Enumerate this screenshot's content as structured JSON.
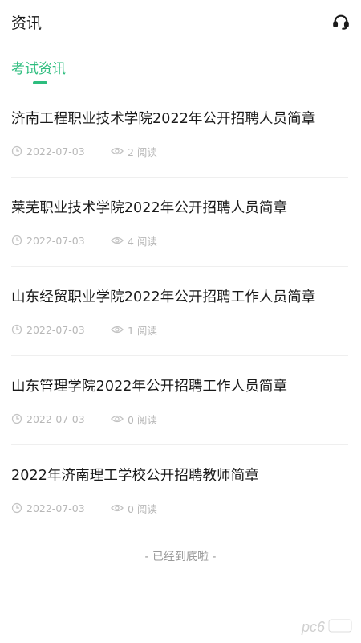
{
  "header": {
    "title": "资讯",
    "service_icon": "headset-icon"
  },
  "tabs": [
    {
      "label": "考试资讯",
      "active": true
    }
  ],
  "articles": [
    {
      "title": "济南工程职业技术学院2022年公开招聘人员简章",
      "date": "2022-07-03",
      "reads": "2 阅读"
    },
    {
      "title": "莱芜职业技术学院2022年公开招聘人员简章",
      "date": "2022-07-03",
      "reads": "4 阅读"
    },
    {
      "title": "山东经贸职业学院2022年公开招聘工作人员简章",
      "date": "2022-07-03",
      "reads": "1 阅读"
    },
    {
      "title": "山东管理学院2022年公开招聘工作人员简章",
      "date": "2022-07-03",
      "reads": "0 阅读"
    },
    {
      "title": "2022年济南理工学校公开招聘教师简章",
      "date": "2022-07-03",
      "reads": "0 阅读"
    }
  ],
  "footer": {
    "end_text": "- 已经到底啦 -"
  },
  "colors": {
    "accent": "#2dbd7e",
    "meta": "#b8b8b8",
    "divider": "#efefef"
  },
  "watermark": {
    "text": "pc6"
  }
}
